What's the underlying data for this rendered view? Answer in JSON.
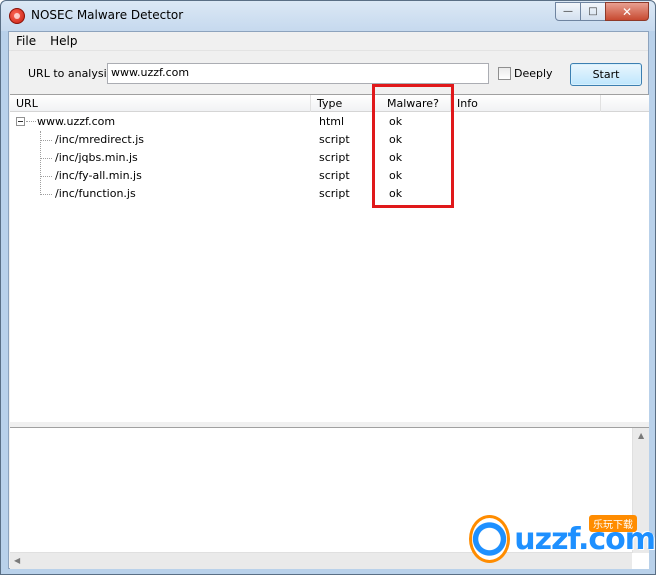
{
  "window": {
    "title": "NOSEC Malware Detector",
    "controls": {
      "minimize": "—",
      "maximize": "□",
      "close": "✕"
    }
  },
  "menu": {
    "items": [
      "File",
      "Help"
    ]
  },
  "toolbar": {
    "url_label": "URL to analysis",
    "url_value": "www.uzzf.com",
    "deeply_label": "Deeply",
    "deeply_checked": false,
    "start_label": "Start"
  },
  "results": {
    "columns": [
      "URL",
      "Type",
      "Malware?",
      "Info"
    ],
    "rows": [
      {
        "url": "www.uzzf.com",
        "type": "html",
        "malware": "ok",
        "info": ""
      },
      {
        "url": "/inc/mredirect.js",
        "type": "script",
        "malware": "ok",
        "info": ""
      },
      {
        "url": "/inc/jqbs.min.js",
        "type": "script",
        "malware": "ok",
        "info": ""
      },
      {
        "url": "/inc/fy-all.min.js",
        "type": "script",
        "malware": "ok",
        "info": ""
      },
      {
        "url": "/inc/function.js",
        "type": "script",
        "malware": "ok",
        "info": ""
      }
    ]
  },
  "watermark": {
    "text": "uzzf.com",
    "tag": "乐玩下载"
  },
  "colors": {
    "highlight": "#e0181a",
    "accent": "#3c7fb1"
  }
}
